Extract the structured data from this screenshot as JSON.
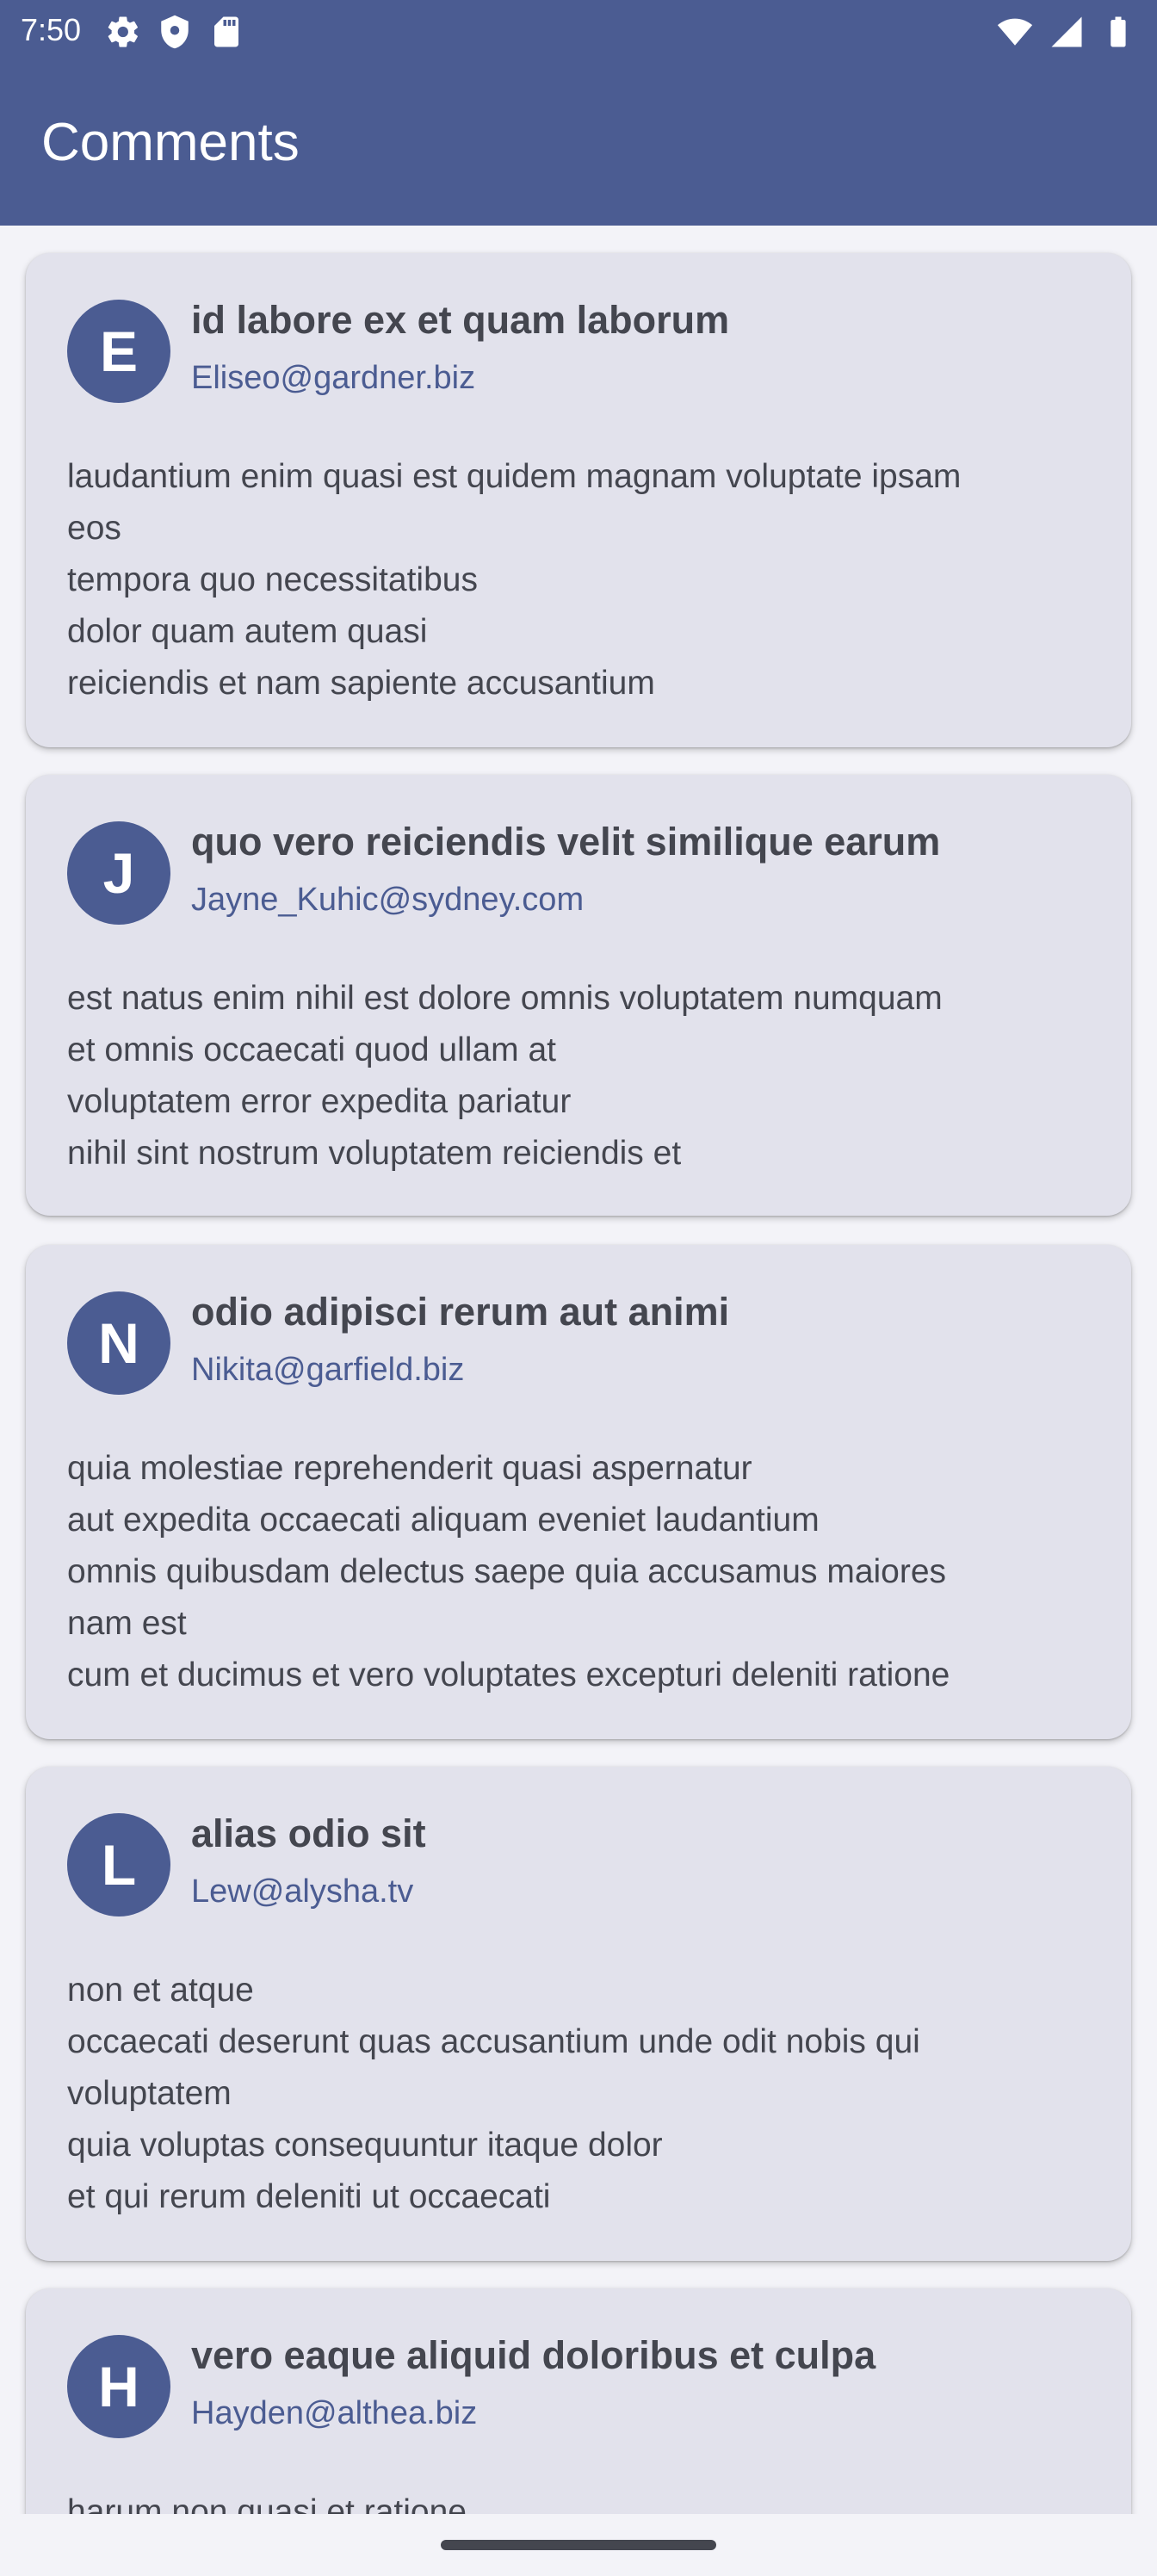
{
  "status_bar": {
    "time": "7:50",
    "left_icons": [
      "gear-icon",
      "shield-icon",
      "sd-card-icon"
    ],
    "right_icons": [
      "wifi-icon",
      "signal-icon",
      "battery-icon"
    ]
  },
  "app_bar": {
    "title": "Comments",
    "background": "#4B5C92"
  },
  "comments": [
    {
      "avatar_letter": "E",
      "title": "id labore ex et quam laborum",
      "email": "Eliseo@gardner.biz",
      "body": "laudantium enim quasi est quidem magnam voluptate ipsam\neos\ntempora quo necessitatibus\ndolor quam autem quasi\nreiciendis et nam sapiente accusantium"
    },
    {
      "avatar_letter": "J",
      "title": "quo vero reiciendis velit similique earum",
      "email": "Jayne_Kuhic@sydney.com",
      "body": "est natus enim nihil est dolore omnis voluptatem numquam\net omnis occaecati quod ullam at\nvoluptatem error expedita pariatur\nnihil sint nostrum voluptatem reiciendis et"
    },
    {
      "avatar_letter": "N",
      "title": "odio adipisci rerum aut animi",
      "email": "Nikita@garfield.biz",
      "body": "quia molestiae reprehenderit quasi aspernatur\naut expedita occaecati aliquam eveniet laudantium\nomnis quibusdam delectus saepe quia accusamus maiores\nnam est\ncum et ducimus et vero voluptates excepturi deleniti ratione"
    },
    {
      "avatar_letter": "L",
      "title": "alias odio sit",
      "email": "Lew@alysha.tv",
      "body": "non et atque\noccaecati deserunt quas accusantium unde odit nobis qui\nvoluptatem\nquia voluptas consequuntur itaque dolor\net qui rerum deleniti ut occaecati"
    },
    {
      "avatar_letter": "H",
      "title": "vero eaque aliquid doloribus et culpa",
      "email": "Hayden@althea.biz",
      "body": "harum non quasi et ratione"
    }
  ],
  "colors": {
    "primary": "#4B5C92",
    "card": "#E2E2EC",
    "background": "#F3F3F8",
    "text": "#44464F"
  }
}
